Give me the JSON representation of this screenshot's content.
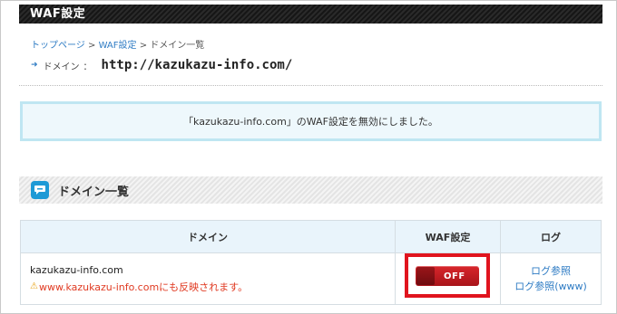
{
  "header": {
    "title": "WAF設定"
  },
  "breadcrumb": {
    "items": [
      "トップページ",
      "WAF設定"
    ],
    "separator": ">",
    "current": "ドメイン一覧"
  },
  "domain_line": {
    "label": "ドメイン",
    "colon": "：",
    "url": "http://kazukazu-info.com/"
  },
  "notice": {
    "message": "「kazukazu-info.com」のWAF設定を無効にしました。"
  },
  "section": {
    "title": "ドメイン一覧",
    "icon": "speech-bubble-icon"
  },
  "table": {
    "headers": [
      "ドメイン",
      "WAF設定",
      "ログ"
    ],
    "rows": [
      {
        "domain": "kazukazu-info.com",
        "warning": "www.kazukazu-info.comにも反映されます。",
        "waf_state": "OFF",
        "log_links": [
          "ログ参照",
          "ログ参照(www)"
        ]
      }
    ]
  },
  "colors": {
    "link": "#2f7cc4",
    "warning": "#e03a22",
    "toggle_off": "#d8262b",
    "highlight": "#e0141e",
    "notice_border": "#bfe6f2"
  }
}
